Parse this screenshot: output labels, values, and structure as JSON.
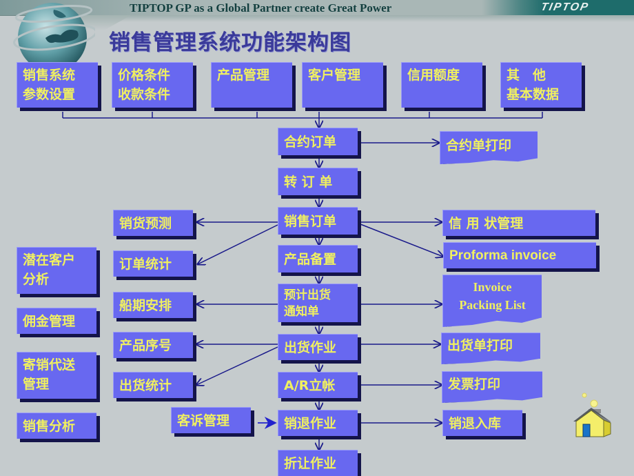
{
  "header": {
    "tagline": "TIPTOP GP as a Global Partner create Great Power",
    "brand": "TIPTOP",
    "title": "销售管理系统功能架构图"
  },
  "colors": {
    "background": "#c5cbcd",
    "box_fill": "#6868f0",
    "box_text": "#f0f060",
    "box_shadow": "#14144a",
    "title": "#3a3a9a",
    "connector": "#1a1a8a"
  },
  "top_row": [
    {
      "line1": "销售系统",
      "line2": "参数设置"
    },
    {
      "line1": "价格条件",
      "line2": "收款条件"
    },
    {
      "line1": "产品管理",
      "line2": ""
    },
    {
      "line1": "客户管理",
      "line2": ""
    },
    {
      "line1": "信用额度",
      "line2": ""
    },
    {
      "line1": "其　他",
      "line2": "基本数据"
    }
  ],
  "main_flow": [
    {
      "label": "合约订单"
    },
    {
      "label": "转 订 单"
    },
    {
      "label": "销售订单"
    },
    {
      "label": "产品备置"
    },
    {
      "line1": "预计出货",
      "line2": "通知单"
    },
    {
      "label": "出货作业"
    },
    {
      "label": "A/R立帐"
    },
    {
      "label": "销退作业"
    },
    {
      "label": "折让作业"
    }
  ],
  "left_branches": [
    {
      "label": "销货预测"
    },
    {
      "label": "订单统计"
    },
    {
      "label": "船期安排"
    },
    {
      "label": "产品序号"
    },
    {
      "label": "出货统计"
    },
    {
      "label": "客诉管理"
    }
  ],
  "right_branches": [
    {
      "label": "合约单打印"
    },
    {
      "label": "信 用 状管理"
    },
    {
      "label": "Proforma invoice"
    },
    {
      "line1": "Invoice",
      "line2": "Packing List"
    },
    {
      "label": "出货单打印"
    },
    {
      "label": "发票打印"
    },
    {
      "label": "销退入库"
    }
  ],
  "far_left": [
    {
      "line1": "潜在客户",
      "line2": "分析"
    },
    {
      "line1": "佣金管理",
      "line2": ""
    },
    {
      "line1": "寄销代送",
      "line2": "管理"
    },
    {
      "line1": "销售分析",
      "line2": ""
    }
  ],
  "icons": {
    "globe": "globe-icon",
    "home": "home-icon"
  }
}
